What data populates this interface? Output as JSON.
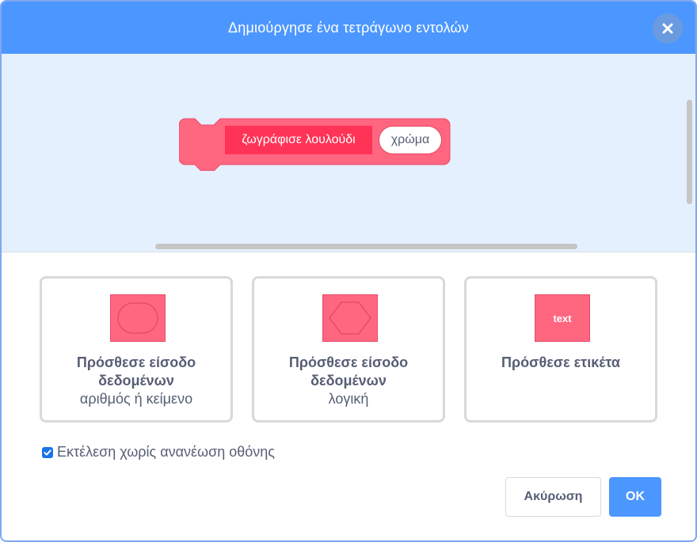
{
  "dialog": {
    "title": "Δημιούργησε ένα τετράγωνο εντολών"
  },
  "preview": {
    "block_label": "ζωγράφισε λουλούδι",
    "block_input": "χρώμα"
  },
  "options": [
    {
      "title": "Πρόσθεσε είσοδο δεδομένων",
      "subtitle": "αριθμός ή κείμενο",
      "icon": "round-input-icon"
    },
    {
      "title": "Πρόσθεσε είσοδο δεδομένων",
      "subtitle": "λογική",
      "icon": "boolean-input-icon"
    },
    {
      "title": "Πρόσθεσε ετικέτα",
      "subtitle": "",
      "icon": "label-text-icon",
      "icon_text": "text"
    }
  ],
  "run_without_refresh": {
    "label": "Εκτέλεση χωρίς ανανέωση οθόνης",
    "checked": true
  },
  "buttons": {
    "cancel": "Ακύρωση",
    "ok": "OK"
  },
  "colors": {
    "header": "#4c97ff",
    "block": "#ff6680",
    "block_label": "#ff3355",
    "preview_bg": "#e5f0ff",
    "text": "#575e75"
  }
}
